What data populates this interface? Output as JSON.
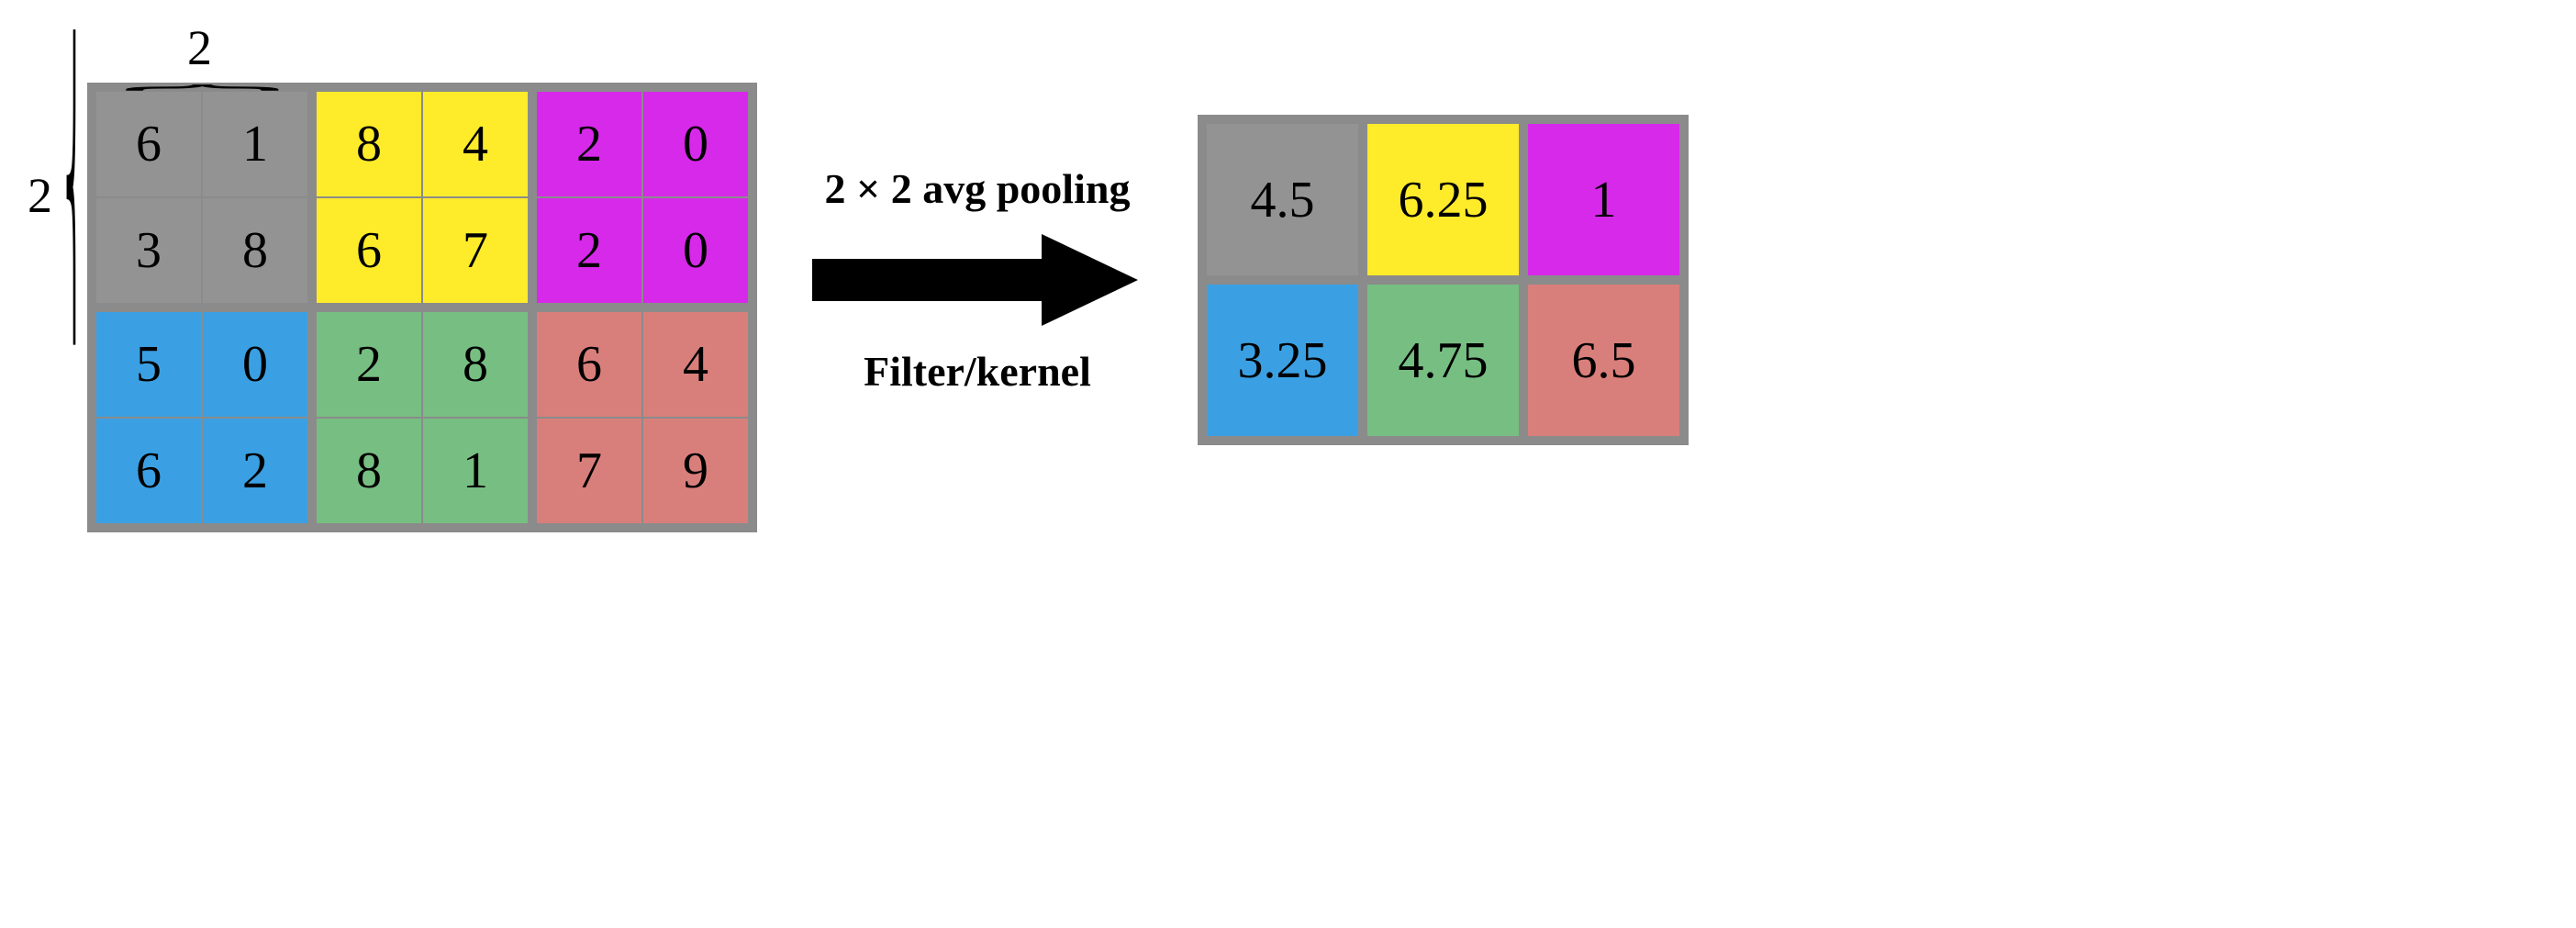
{
  "kernel": {
    "width_label": "2",
    "height_label": "2"
  },
  "arrow": {
    "top_text": "2 × 2 avg pooling",
    "bottom_text": "Filter/kernel"
  },
  "colors": {
    "gray": "#939393",
    "yellow": "#feeb2a",
    "magenta": "#d729ea",
    "blue": "#3ba0e3",
    "green": "#77be82",
    "red": "#d97f7b"
  },
  "input": {
    "rows": 4,
    "cols": 6,
    "region_color": [
      [
        "gray",
        "gray",
        "yellow",
        "yellow",
        "magenta",
        "magenta"
      ],
      [
        "gray",
        "gray",
        "yellow",
        "yellow",
        "magenta",
        "magenta"
      ],
      [
        "blue",
        "blue",
        "green",
        "green",
        "red",
        "red"
      ],
      [
        "blue",
        "blue",
        "green",
        "green",
        "red",
        "red"
      ]
    ],
    "values": [
      [
        6,
        1,
        8,
        4,
        2,
        0
      ],
      [
        3,
        8,
        6,
        7,
        2,
        0
      ],
      [
        5,
        0,
        2,
        8,
        6,
        4
      ],
      [
        6,
        2,
        8,
        1,
        7,
        9
      ]
    ]
  },
  "output": {
    "rows": 2,
    "cols": 3,
    "region_color": [
      [
        "gray",
        "yellow",
        "magenta"
      ],
      [
        "blue",
        "green",
        "red"
      ]
    ],
    "values": [
      [
        4.5,
        6.25,
        1
      ],
      [
        3.25,
        4.75,
        6.5
      ]
    ]
  },
  "chart_data": {
    "type": "table",
    "operation": "2x2 average pooling",
    "kernel_size": [
      2,
      2
    ],
    "stride": [
      2,
      2
    ],
    "input_matrix": {
      "shape": [
        4,
        6
      ],
      "values": [
        [
          6,
          1,
          8,
          4,
          2,
          0
        ],
        [
          3,
          8,
          6,
          7,
          2,
          0
        ],
        [
          5,
          0,
          2,
          8,
          6,
          4
        ],
        [
          6,
          2,
          8,
          1,
          7,
          9
        ]
      ]
    },
    "output_matrix": {
      "shape": [
        2,
        3
      ],
      "values": [
        [
          4.5,
          6.25,
          1
        ],
        [
          3.25,
          4.75,
          6.5
        ]
      ]
    },
    "regions": {
      "gray": {
        "input_cells": [
          [
            0,
            0
          ],
          [
            0,
            1
          ],
          [
            1,
            0
          ],
          [
            1,
            1
          ]
        ],
        "output_cell": [
          0,
          0
        ],
        "avg": 4.5
      },
      "yellow": {
        "input_cells": [
          [
            0,
            2
          ],
          [
            0,
            3
          ],
          [
            1,
            2
          ],
          [
            1,
            3
          ]
        ],
        "output_cell": [
          0,
          1
        ],
        "avg": 6.25
      },
      "magenta": {
        "input_cells": [
          [
            0,
            4
          ],
          [
            0,
            5
          ],
          [
            1,
            4
          ],
          [
            1,
            5
          ]
        ],
        "output_cell": [
          0,
          2
        ],
        "avg": 1
      },
      "blue": {
        "input_cells": [
          [
            2,
            0
          ],
          [
            2,
            1
          ],
          [
            3,
            0
          ],
          [
            3,
            1
          ]
        ],
        "output_cell": [
          1,
          0
        ],
        "avg": 3.25
      },
      "green": {
        "input_cells": [
          [
            2,
            2
          ],
          [
            2,
            3
          ],
          [
            3,
            2
          ],
          [
            3,
            3
          ]
        ],
        "output_cell": [
          1,
          1
        ],
        "avg": 4.75
      },
      "red": {
        "input_cells": [
          [
            2,
            4
          ],
          [
            2,
            5
          ],
          [
            3,
            4
          ],
          [
            3,
            5
          ]
        ],
        "output_cell": [
          1,
          2
        ],
        "avg": 6.5
      }
    }
  }
}
